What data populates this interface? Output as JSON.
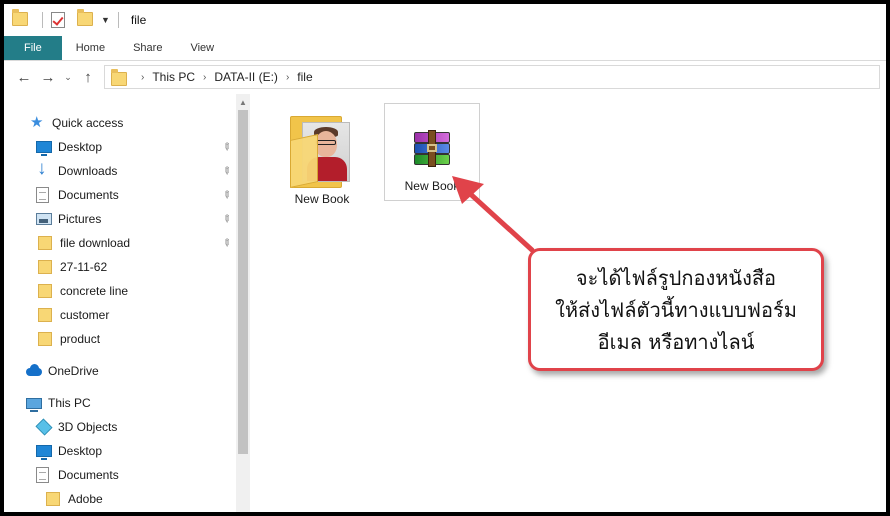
{
  "titlebar": {
    "title": "file"
  },
  "ribbon": {
    "tabs": [
      "File",
      "Home",
      "Share",
      "View"
    ]
  },
  "address": {
    "crumbs": [
      "This PC",
      "DATA-II (E:)",
      "file"
    ]
  },
  "sidebar": {
    "items": [
      {
        "label": "Quick access",
        "icon": "star-icon",
        "pinned": false
      },
      {
        "label": "Desktop",
        "icon": "desktop-icon",
        "pinned": true
      },
      {
        "label": "Downloads",
        "icon": "download-icon",
        "pinned": true
      },
      {
        "label": "Documents",
        "icon": "document-icon",
        "pinned": true
      },
      {
        "label": "Pictures",
        "icon": "pictures-icon",
        "pinned": true
      },
      {
        "label": "file download",
        "icon": "folder-icon",
        "pinned": true
      },
      {
        "label": "27-11-62",
        "icon": "folder-icon",
        "pinned": false
      },
      {
        "label": "concrete line",
        "icon": "folder-icon",
        "pinned": false
      },
      {
        "label": "customer",
        "icon": "folder-icon",
        "pinned": false
      },
      {
        "label": "product",
        "icon": "folder-icon",
        "pinned": false
      },
      {
        "label": "OneDrive",
        "icon": "cloud-icon",
        "pinned": false
      },
      {
        "label": "This PC",
        "icon": "computer-icon",
        "pinned": false
      },
      {
        "label": "3D Objects",
        "icon": "cube-icon",
        "pinned": false
      },
      {
        "label": "Desktop",
        "icon": "desktop-icon",
        "pinned": false
      },
      {
        "label": "Documents",
        "icon": "document-icon",
        "pinned": false
      },
      {
        "label": "Adobe",
        "icon": "folder-icon",
        "pinned": false
      }
    ]
  },
  "content": {
    "files": [
      {
        "label": "New Book",
        "type": "folder"
      },
      {
        "label": "New Book",
        "type": "rar-archive"
      }
    ]
  },
  "callout": {
    "lines": [
      "จะได้ไฟล์รูปกองหนังสือ",
      "ให้ส่งไฟล์ตัวนี้ทางแบบฟอร์ม",
      "อีเมล หรือทางไลน์"
    ]
  },
  "colors": {
    "file_tab": "#237d88",
    "callout_border": "#e0434a",
    "arrow": "#e0434a"
  }
}
